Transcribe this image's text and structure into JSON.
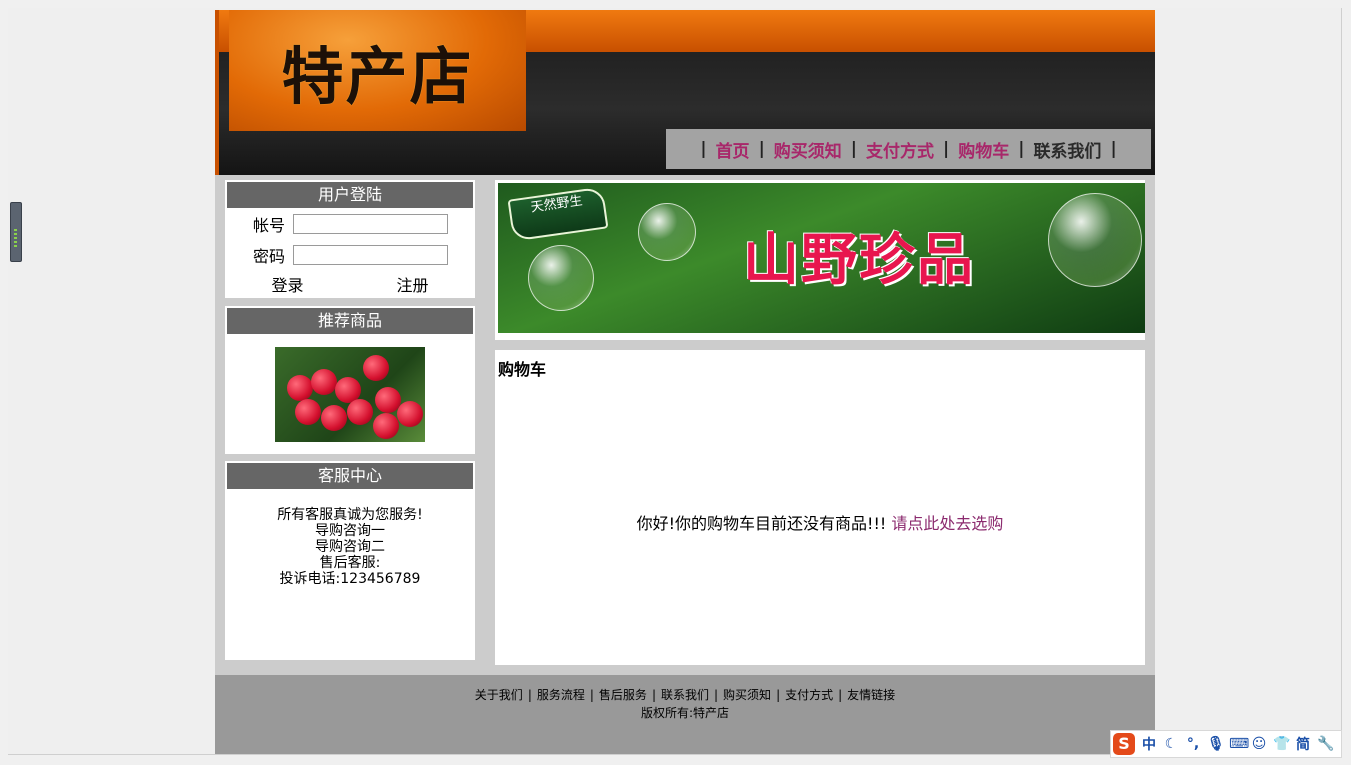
{
  "header": {
    "logo_text": "特产店",
    "nav": [
      {
        "label": "首页",
        "style": "pink"
      },
      {
        "label": "购买须知",
        "style": "pink"
      },
      {
        "label": "支付方式",
        "style": "pink"
      },
      {
        "label": "购物车",
        "style": "pink"
      },
      {
        "label": "联系我们",
        "style": "dark"
      }
    ],
    "nav_separator": "|"
  },
  "login": {
    "title": "用户登陆",
    "account_label": "帐号",
    "account_value": "",
    "password_label": "密码",
    "password_value": "",
    "login_label": "登录",
    "register_label": "注册"
  },
  "recommend": {
    "title": "推荐商品"
  },
  "service": {
    "title": "客服中心",
    "lines": [
      "所有客服真诚为您服务!",
      "导购咨询一",
      "导购咨询二",
      "售后客服:",
      "投诉电话:123456789"
    ]
  },
  "banner": {
    "tag": "天然野生",
    "title": "山野珍品"
  },
  "cart": {
    "title": "购物车",
    "message": "你好!你的购物车目前还没有商品!!!",
    "link_text": "请点此处去选购"
  },
  "footer": {
    "links": [
      "关于我们",
      "服务流程",
      "售后服务",
      "联系我们",
      "购买须知",
      "支付方式",
      "友情链接"
    ],
    "separator": "|",
    "copyright": "版权所有:特产店"
  },
  "ime": {
    "logo": "S",
    "mode": "中",
    "simplified": "简"
  },
  "colors": {
    "orange": "#e26a06",
    "nav_pink": "#a8276a",
    "link_purple": "#8b2a6e",
    "title_bar": "#666666",
    "footer_bg": "#999999"
  }
}
